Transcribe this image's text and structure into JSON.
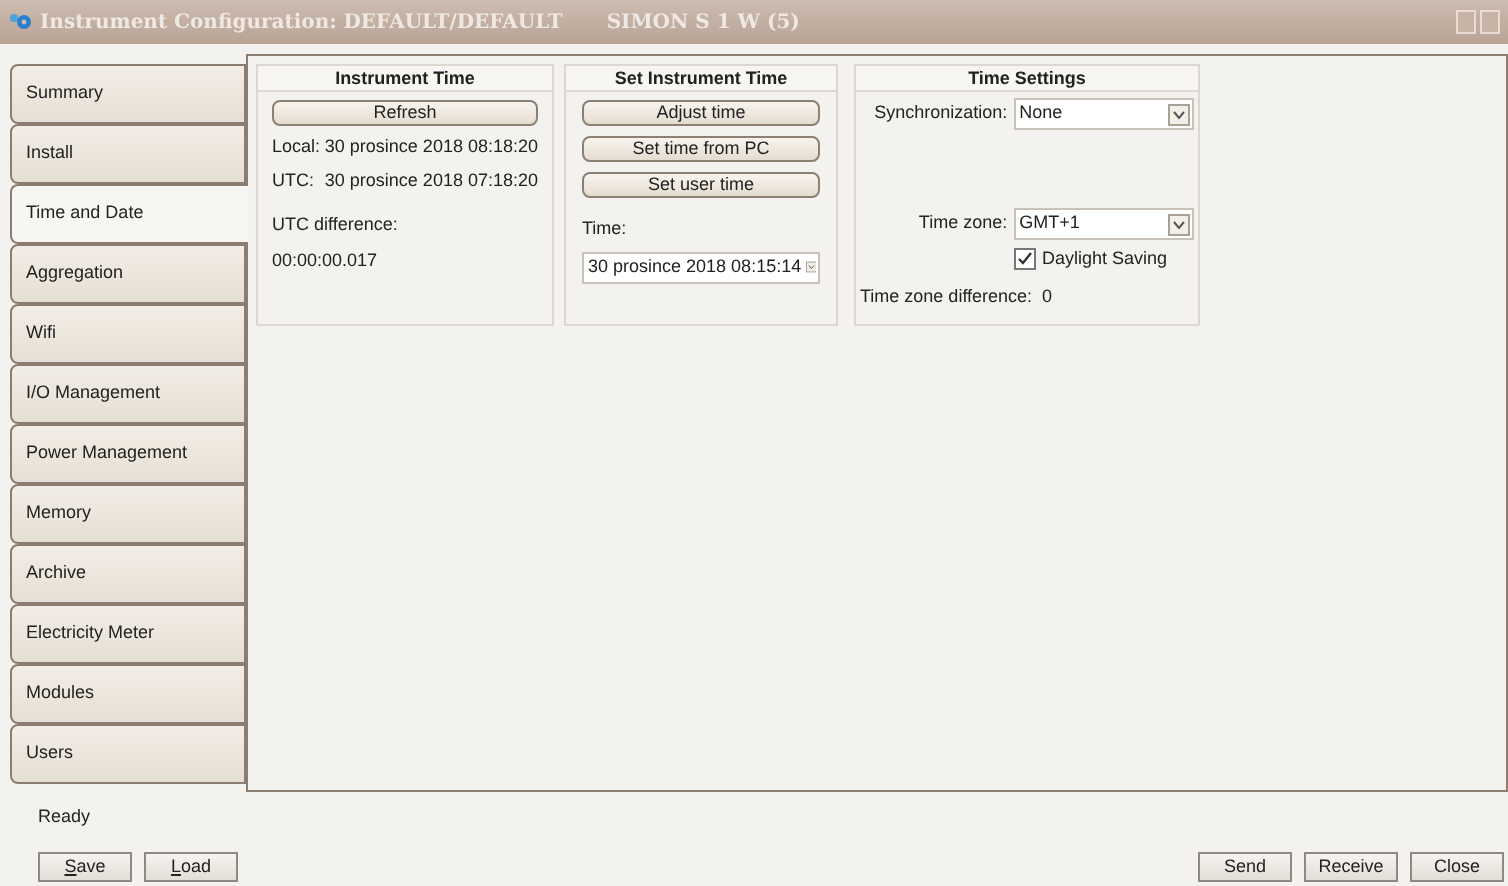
{
  "window": {
    "title": "Instrument Configuration: DEFAULT/DEFAULT",
    "subtitle": "SIMON S 1 W (5)"
  },
  "tabs": [
    {
      "label": "Summary",
      "selected": false
    },
    {
      "label": "Install",
      "selected": false
    },
    {
      "label": "Time and Date",
      "selected": true
    },
    {
      "label": "Aggregation",
      "selected": false
    },
    {
      "label": "Wifi",
      "selected": false
    },
    {
      "label": "I/O Management",
      "selected": false
    },
    {
      "label": "Power Management",
      "selected": false
    },
    {
      "label": "Memory",
      "selected": false
    },
    {
      "label": "Archive",
      "selected": false
    },
    {
      "label": "Electricity Meter",
      "selected": false
    },
    {
      "label": "Modules",
      "selected": false
    },
    {
      "label": "Users",
      "selected": false
    }
  ],
  "instrument_time": {
    "title": "Instrument Time",
    "button": "Refresh",
    "rows": [
      {
        "label": "Local:",
        "value": "30 prosince 2018 08:18:20"
      },
      {
        "label": "UTC:",
        "value": "30 prosince 2018 07:18:20"
      }
    ],
    "difference_label": "UTC difference:",
    "difference_value": "00:00:00.017"
  },
  "set_instrument_time": {
    "title": "Set Instrument Time",
    "buttons": [
      "Adjust time",
      "Set time from PC",
      "Set user time"
    ],
    "time_label": "Time:",
    "time_value": "30 prosince 2018 08:15:14"
  },
  "time_settings": {
    "title": "Time Settings",
    "synchronization_label": "Synchronization:",
    "synchronization_value": "None",
    "time_zone_label": "Time zone:",
    "time_zone_value": "GMT+1",
    "daylight_saving": {
      "label": "Daylight Saving",
      "checked": true
    },
    "difference": "Time zone difference:  0"
  },
  "status_bar": "Ready",
  "left_buttons": [
    {
      "label": "Save",
      "mnemonic": true
    },
    {
      "label": "Load",
      "mnemonic": true
    }
  ],
  "right_buttons": [
    {
      "label": "Send",
      "mnemonic": false
    },
    {
      "label": "Receive",
      "mnemonic": false
    },
    {
      "label": "Close",
      "mnemonic": false
    }
  ]
}
